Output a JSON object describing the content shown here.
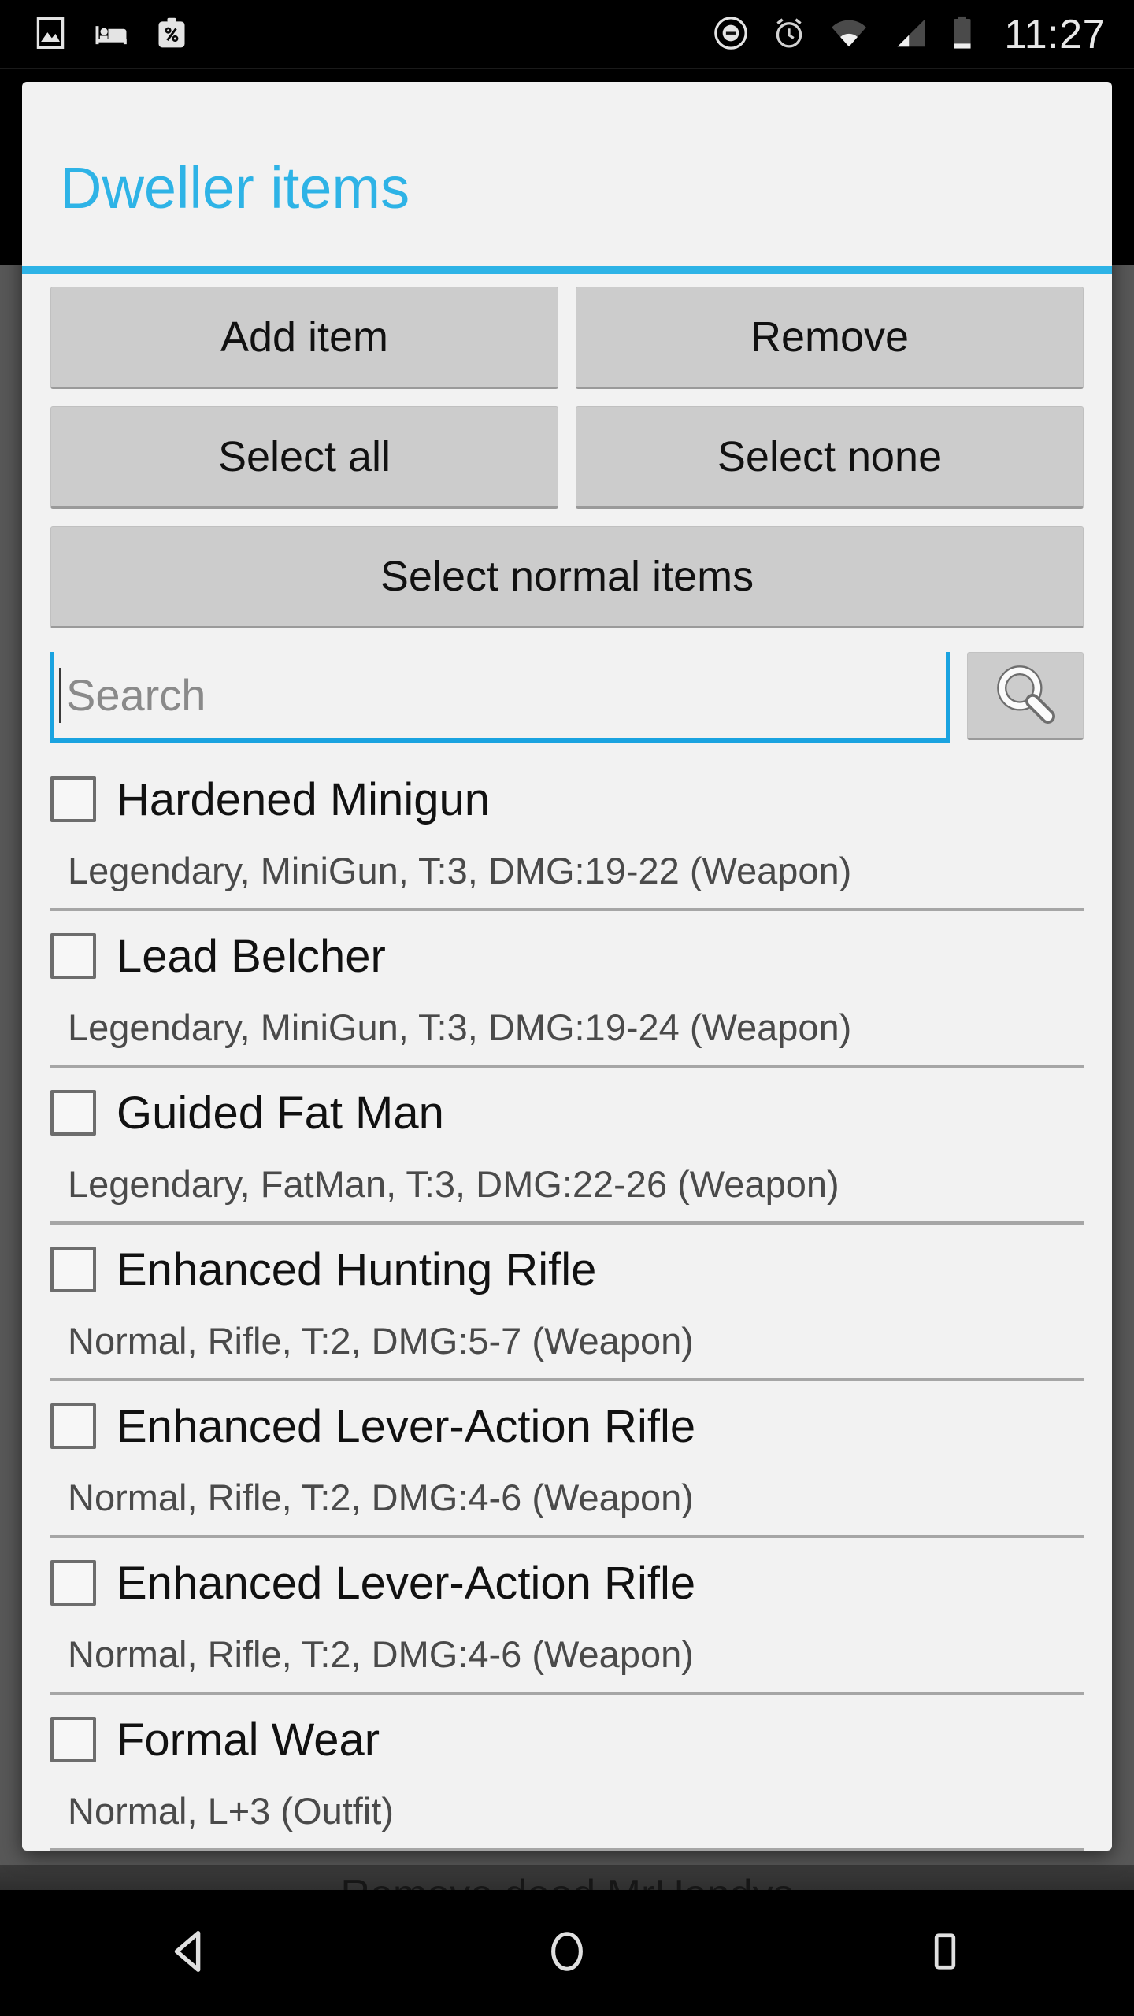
{
  "statusbar": {
    "time": "11:27",
    "notification_icons": [
      "image-icon",
      "bed-icon",
      "briefcase-percent-icon"
    ],
    "system_icons": [
      "do-not-disturb-icon",
      "alarm-icon",
      "wifi-icon",
      "cellular-signal-icon",
      "battery-icon"
    ]
  },
  "dialog": {
    "title": "Dweller items",
    "accent_color": "#2eb3e6",
    "background_color": "#f2f2f2"
  },
  "buttons": {
    "add_item": "Add item",
    "remove": "Remove",
    "select_all": "Select all",
    "select_none": "Select none",
    "select_normal_items": "Select normal items"
  },
  "search": {
    "value": "",
    "placeholder": "Search",
    "button_icon": "search-icon",
    "underline_color": "#1aa3e0"
  },
  "list": {
    "items": [
      {
        "name": "Hardened Minigun",
        "details": "Legendary, MiniGun, T:3, DMG:19-22 (Weapon)",
        "checked": false
      },
      {
        "name": "Lead Belcher",
        "details": "Legendary, MiniGun, T:3, DMG:19-24 (Weapon)",
        "checked": false
      },
      {
        "name": "Guided Fat Man",
        "details": "Legendary, FatMan, T:3, DMG:22-26 (Weapon)",
        "checked": false
      },
      {
        "name": "Enhanced Hunting Rifle",
        "details": "Normal, Rifle, T:2, DMG:5-7 (Weapon)",
        "checked": false
      },
      {
        "name": "Enhanced Lever-Action Rifle",
        "details": "Normal, Rifle, T:2, DMG:4-6 (Weapon)",
        "checked": false
      },
      {
        "name": "Enhanced Lever-Action Rifle",
        "details": "Normal, Rifle, T:2, DMG:4-6 (Weapon)",
        "checked": false
      },
      {
        "name": "Formal Wear",
        "details": "Normal, L+3 (Outfit)",
        "checked": false
      }
    ]
  },
  "background_app": {
    "partial_row_label": "Remove dead MrHandys"
  },
  "navbar": {
    "back": "back-button",
    "home": "home-button",
    "recents": "recents-button"
  }
}
